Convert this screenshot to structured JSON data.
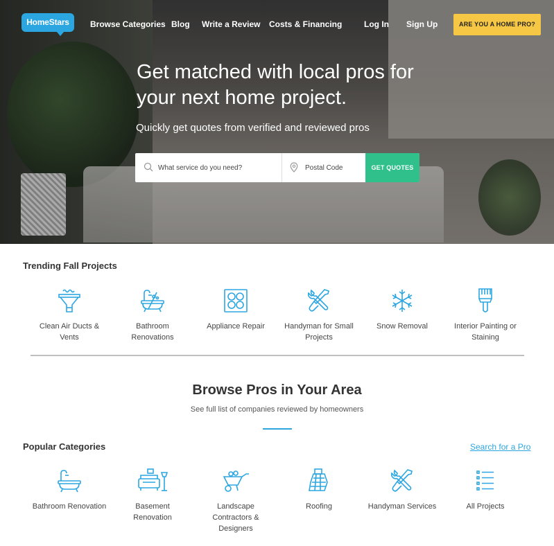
{
  "brand": {
    "name": "HomeStars",
    "color": "#2ba6e0"
  },
  "nav": {
    "links": [
      "Browse Categories",
      "Blog",
      "Write a Review",
      "Costs & Financing"
    ],
    "login": "Log In",
    "signup": "Sign Up",
    "pro_button": "ARE YOU A HOME PRO?"
  },
  "hero": {
    "headline": "Get matched with local pros for your next home project.",
    "subheadline": "Quickly get quotes from verified and reviewed pros",
    "search": {
      "service_placeholder": "What service do you need?",
      "postal_placeholder": "Postal Code",
      "button": "GET QUOTES"
    }
  },
  "trending": {
    "title": "Trending Fall Projects",
    "items": [
      {
        "label": "Clean Air Ducts & Vents",
        "icon": "air-duct-icon"
      },
      {
        "label": "Bathroom Renovations",
        "icon": "bathtub-icon"
      },
      {
        "label": "Appliance Repair",
        "icon": "stovetop-icon"
      },
      {
        "label": "Handyman for Small Projects",
        "icon": "wrench-screwdriver-icon"
      },
      {
        "label": "Snow Removal",
        "icon": "snowflake-icon"
      },
      {
        "label": "Interior Painting or Staining",
        "icon": "paintbrush-icon"
      }
    ]
  },
  "browse": {
    "title": "Browse Pros in Your Area",
    "subtitle": "See full list of companies reviewed by homeowners"
  },
  "popular": {
    "title": "Popular Categories",
    "search_link": "Search for a Pro",
    "items": [
      {
        "label": "Bathroom Renovation",
        "icon": "bathtub-icon"
      },
      {
        "label": "Basement Renovation",
        "icon": "sofa-lamp-icon"
      },
      {
        "label": "Landscape Contractors & Designers",
        "icon": "wheelbarrow-icon"
      },
      {
        "label": "Roofing",
        "icon": "roof-icon"
      },
      {
        "label": "Handyman Services",
        "icon": "wrench-screwdriver-icon"
      },
      {
        "label": "All Projects",
        "icon": "list-icon"
      }
    ]
  },
  "colors": {
    "accent_yellow": "#f6c744",
    "accent_green": "#2fc08c",
    "link_blue": "#2ba6e0"
  }
}
